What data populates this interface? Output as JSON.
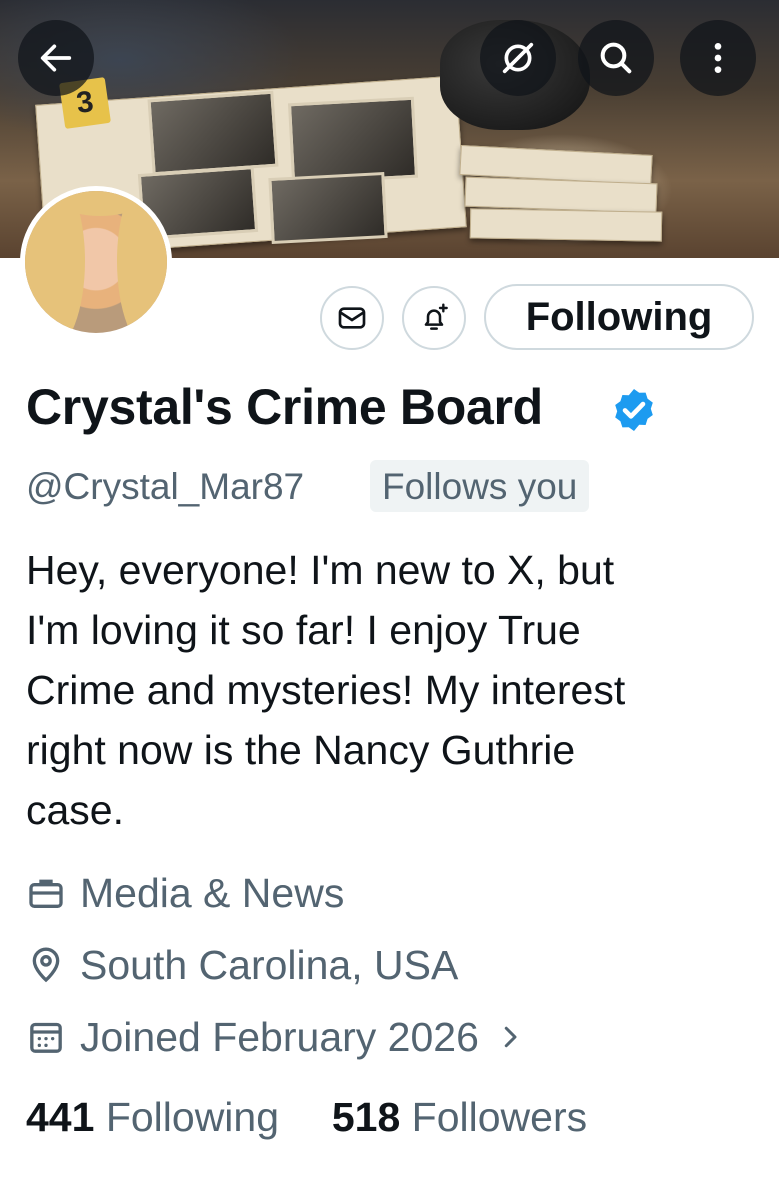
{
  "header": {
    "back_icon": "arrow-left-icon",
    "grok_icon": "grok-icon",
    "search_icon": "search-icon",
    "more_icon": "more-vertical-icon",
    "evidence_marker": "3"
  },
  "actions": {
    "message_icon": "envelope-icon",
    "notify_icon": "bell-plus-icon",
    "following_label": "Following"
  },
  "profile": {
    "display_name": "Crystal's Crime Board",
    "verified_icon": "verified-badge-icon",
    "handle": "@Crystal_Mar87",
    "follows_you": "Follows you",
    "bio": "Hey, everyone! I'm new to X, but\nI'm loving it so far! I enjoy True\nCrime and mysteries! My interest\nright now is the Nancy Guthrie\ncase.",
    "category": "Media & News",
    "location": "South Carolina, USA",
    "joined": "Joined February 2026"
  },
  "stats": {
    "following_count": "441",
    "following_label": "Following",
    "followers_count": "518",
    "followers_label": "Followers"
  },
  "colors": {
    "verified_blue": "#1d9bf0",
    "secondary_text": "#536471",
    "border": "#cfd9de"
  }
}
